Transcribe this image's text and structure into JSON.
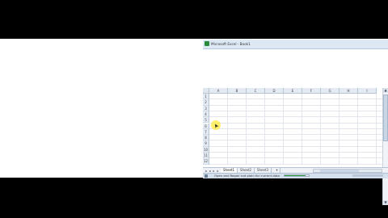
{
  "window": {
    "title": "Microsoft Excel - Book1"
  },
  "columns": [
    "A",
    "B",
    "C",
    "D",
    "E",
    "F",
    "G",
    "H",
    "I"
  ],
  "rows": [
    "1",
    "2",
    "3",
    "4",
    "5",
    "6",
    "7",
    "8",
    "9",
    "10",
    "11",
    "12"
  ],
  "sheet_tabs": [
    "Sheet1",
    "Sheet2",
    "Sheet3"
  ],
  "active_sheet": "Sheet1",
  "status": {
    "text": "Open and Repair not plain for current data",
    "progress": 0.85
  },
  "colors": {
    "title_bar": "#dde8f5",
    "status_bar": "#d5e0ee",
    "cursor_highlight": "#ffeb3c",
    "progress": "#3aa23a"
  }
}
